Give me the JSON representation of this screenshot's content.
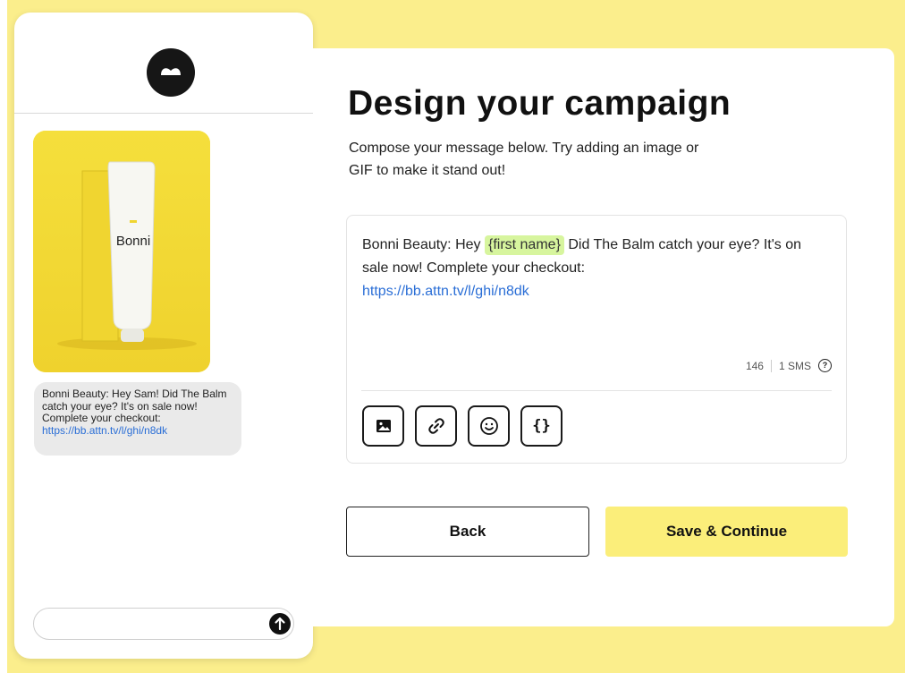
{
  "colors": {
    "accent_yellow": "#fbee8c",
    "button_yellow": "#fbee7a",
    "token_green": "#d7f59e",
    "link_blue": "#2a6ed6"
  },
  "phone": {
    "product_brand": "Bonni",
    "bubble": {
      "text": "Bonni Beauty: Hey Sam! Did The Balm catch your eye? It's on sale now! Complete your checkout:",
      "link": "https://bb.attn.tv/l/ghi/n8dk"
    },
    "input_placeholder": ""
  },
  "main": {
    "title": "Design your campaign",
    "subtitle_line1": "Compose your message below. Try adding an image or",
    "subtitle_line2": "GIF to make it stand out!",
    "composer": {
      "text_before": "Bonni Beauty: Hey ",
      "token_open": "{",
      "token_label": "first name",
      "token_close": "}",
      "text_after": " Did The Balm catch your eye? It's on sale now! Complete your checkout:",
      "link": "https://bb.attn.tv/l/ghi/n8dk",
      "char_count": "146",
      "sms_count": "1 SMS",
      "help_glyph": "?"
    },
    "tools": [
      {
        "icon": "image-icon"
      },
      {
        "icon": "link-icon"
      },
      {
        "icon": "emoji-icon"
      },
      {
        "icon": "braces-icon",
        "glyph": "{}"
      }
    ],
    "back_label": "Back",
    "save_label": "Save & Continue"
  }
}
